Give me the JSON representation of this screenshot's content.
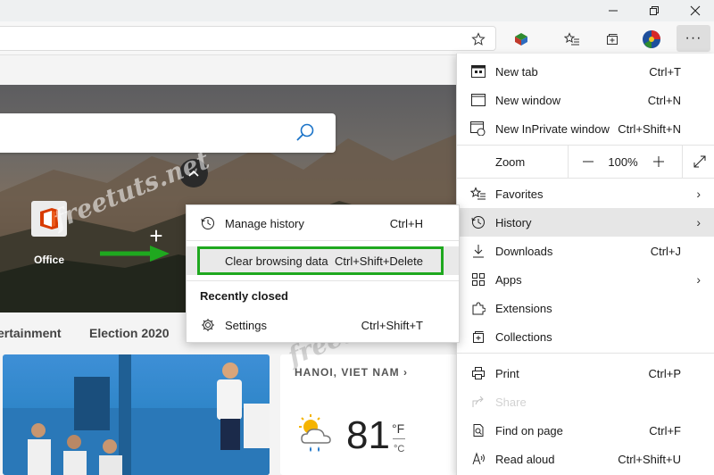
{
  "window": {
    "minimize_icon": "minimize-icon",
    "restore_icon": "restore-icon",
    "close_icon": "close-icon"
  },
  "toolbar": {
    "more_label": "···"
  },
  "page": {
    "office_label": "Office",
    "nav_tabs": [
      "ertainment",
      "Election 2020"
    ],
    "weather": {
      "location": "HANOI, VIET NAM",
      "temp": "81",
      "unit_f": "°F",
      "unit_c": "°C"
    },
    "watermark": "freetuts.net"
  },
  "menu": {
    "items": [
      {
        "label": "New tab",
        "shortcut": "Ctrl+T",
        "icon": "new-tab-icon"
      },
      {
        "label": "New window",
        "shortcut": "Ctrl+N",
        "icon": "new-window-icon"
      },
      {
        "label": "New InPrivate window",
        "shortcut": "Ctrl+Shift+N",
        "icon": "inprivate-icon"
      },
      {
        "label": "Favorites",
        "shortcut": "",
        "icon": "favorites-icon"
      },
      {
        "label": "History",
        "shortcut": "",
        "icon": "history-icon"
      },
      {
        "label": "Downloads",
        "shortcut": "Ctrl+J",
        "icon": "download-icon"
      },
      {
        "label": "Apps",
        "shortcut": "",
        "icon": "apps-icon"
      },
      {
        "label": "Extensions",
        "shortcut": "",
        "icon": "extensions-icon"
      },
      {
        "label": "Collections",
        "shortcut": "",
        "icon": "collections-icon"
      },
      {
        "label": "Print",
        "shortcut": "Ctrl+P",
        "icon": "print-icon"
      },
      {
        "label": "Share",
        "shortcut": "",
        "icon": "share-icon"
      },
      {
        "label": "Find on page",
        "shortcut": "Ctrl+F",
        "icon": "find-icon"
      },
      {
        "label": "Read aloud",
        "shortcut": "Ctrl+Shift+U",
        "icon": "read-aloud-icon"
      }
    ],
    "zoom": {
      "label": "Zoom",
      "minus": "—",
      "value": "100%",
      "plus": "+"
    }
  },
  "history_submenu": {
    "manage": {
      "label": "Manage history",
      "shortcut": "Ctrl+H"
    },
    "clear": {
      "label": "Clear browsing data",
      "shortcut": "Ctrl+Shift+Delete"
    },
    "recently_closed": "Recently closed",
    "settings": {
      "label": "Settings",
      "shortcut": "Ctrl+Shift+T"
    }
  },
  "colors": {
    "highlight_box": "#1fa81f",
    "arrow": "#1fa81f",
    "office_brand": "#d83b01"
  }
}
